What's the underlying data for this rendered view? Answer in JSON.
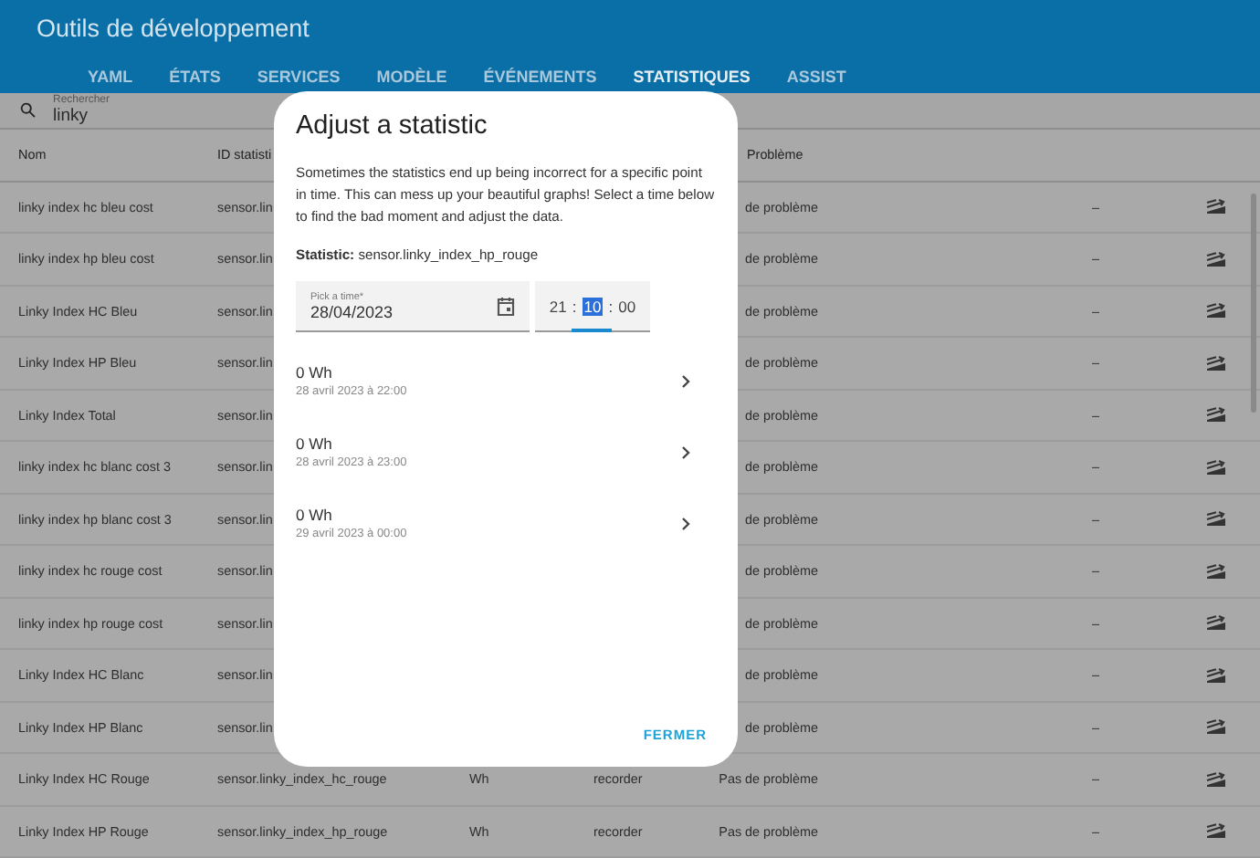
{
  "header": {
    "title": "Outils de développement",
    "tabs": [
      {
        "label": "YAML",
        "selected": false
      },
      {
        "label": "ÉTATS",
        "selected": false
      },
      {
        "label": "SERVICES",
        "selected": false
      },
      {
        "label": "MODÈLE",
        "selected": false
      },
      {
        "label": "ÉVÉNEMENTS",
        "selected": false
      },
      {
        "label": "STATISTIQUES",
        "selected": true
      },
      {
        "label": "ASSIST",
        "selected": false
      }
    ]
  },
  "search": {
    "label": "Rechercher",
    "value": "linky"
  },
  "table": {
    "columns": [
      "Nom",
      "ID statisti",
      "Problème"
    ],
    "rows": [
      {
        "name": "linky index hc bleu cost",
        "statistic_id": "sensor.lin",
        "problem": "de problème",
        "column_6": "–"
      },
      {
        "name": "linky index hp bleu cost",
        "statistic_id": "sensor.lin",
        "problem": "de problème",
        "column_6": "–"
      },
      {
        "name": "Linky Index HC Bleu",
        "statistic_id": "sensor.lin",
        "problem": "de problème",
        "column_6": "–"
      },
      {
        "name": "Linky Index HP Bleu",
        "statistic_id": "sensor.lin",
        "problem": "de problème",
        "column_6": "–"
      },
      {
        "name": "Linky Index Total",
        "statistic_id": "sensor.lin",
        "problem": "de problème",
        "column_6": "–"
      },
      {
        "name": "linky index hc blanc cost 3",
        "statistic_id": "sensor.lin",
        "problem": "de problème",
        "column_6": "–"
      },
      {
        "name": "linky index hp blanc cost 3",
        "statistic_id": "sensor.lin",
        "problem": "de problème",
        "column_6": "–"
      },
      {
        "name": "linky index hc rouge cost",
        "statistic_id": "sensor.lin",
        "problem": "de problème",
        "column_6": "–"
      },
      {
        "name": "linky index hp rouge cost",
        "statistic_id": "sensor.lin",
        "problem": "de problème",
        "column_6": "–"
      },
      {
        "name": "Linky Index HC Blanc",
        "statistic_id": "sensor.lin",
        "problem": "de problème",
        "column_6": "–"
      },
      {
        "name": "Linky Index HP Blanc",
        "statistic_id": "sensor.lin",
        "problem": "de problème",
        "column_6": "–"
      },
      {
        "name": "Linky Index HC Rouge",
        "statistic_id": "sensor.linky_index_hc_rouge",
        "column_3": "Wh",
        "column_4": "recorder",
        "problem": "Pas de problème",
        "column_6": "–"
      },
      {
        "name": "Linky Index HP Rouge",
        "statistic_id": "sensor.linky_index_hp_rouge",
        "column_3": "Wh",
        "column_4": "recorder",
        "problem": "Pas de problème",
        "column_6": "–"
      }
    ]
  },
  "dialog": {
    "title": "Adjust a statistic",
    "description": "Sometimes the statistics end up being incorrect for a specific point in time. This can mess up your beautiful graphs! Select a time below to find the bad moment and adjust the data.",
    "statistic": "**Statistic:** sensor.linky_index_hp_rouge",
    "date_field": {
      "label": "Pick a time*",
      "value": "28/04/2023"
    },
    "time_field": {
      "segments": [
        {
          "text": "21",
          "selected": false
        },
        {
          "text": "10",
          "selected": true
        },
        {
          "text": "00",
          "selected": false
        }
      ],
      "separators": [
        ":",
        ":"
      ]
    },
    "points": [
      {
        "value": "0 Wh",
        "date": "28 avril 2023 à 22:00"
      },
      {
        "value": "0 Wh",
        "date": "28 avril 2023 à 23:00"
      },
      {
        "value": "0 Wh",
        "date": "29 avril 2023 à 00:00"
      }
    ],
    "close_button": "FERMER"
  }
}
